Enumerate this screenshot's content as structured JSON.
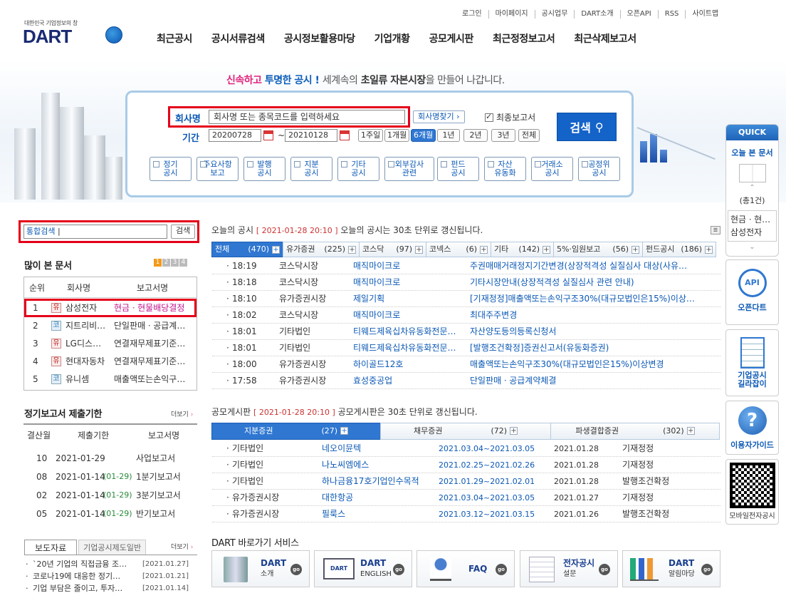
{
  "header": {
    "top_links": [
      "로그인",
      "마이페이지",
      "공시업무",
      "DART소개",
      "오픈API",
      "RSS",
      "사이트맵"
    ],
    "logo_sub": "대한민국 기업정보의 창",
    "logo": "DART",
    "nav": [
      "최근공시",
      "공시서류검색",
      "공시정보활용마당",
      "기업개황",
      "공모게시판",
      "최근정정보고서",
      "최근삭제보고서"
    ]
  },
  "tagline": {
    "p1": "신속하고",
    "p2": "투명한 공시 !",
    "p3": "세계속의",
    "p4": "초일류",
    "p5": "자본시장",
    "p6": "을 만들어 나갑니다."
  },
  "search": {
    "company_label": "회사명",
    "company_placeholder": "회사명 또는 종목코드를 입력하세요",
    "find_btn": "회사명찾기 ›",
    "final_report_label": "최종보고서",
    "period_label": "기간",
    "date_from": "20200728",
    "date_to": "20210128",
    "tilde": "~",
    "periods": [
      "1주일",
      "1개월",
      "6개월",
      "1년",
      "2년",
      "3년",
      "전체"
    ],
    "period_selected": "6개월",
    "search_btn": "검색",
    "categories": [
      [
        "정기",
        "공시"
      ],
      [
        "주요사항",
        "보고"
      ],
      [
        "발행",
        "공시"
      ],
      [
        "지분",
        "공시"
      ],
      [
        "기타",
        "공시"
      ],
      [
        "외부감사",
        "관련"
      ],
      [
        "펀드",
        "공시"
      ],
      [
        "자산",
        "유동화"
      ],
      [
        "거래소",
        "공시"
      ],
      [
        "공정위",
        "공시"
      ]
    ]
  },
  "integrated": {
    "placeholder": "통합검색",
    "btn": "검색"
  },
  "most_viewed": {
    "title": "많이 본 문서",
    "pages": [
      "1",
      "2",
      "3",
      "4"
    ],
    "headers": [
      "순위",
      "회사명",
      "보고서명"
    ],
    "rows": [
      {
        "rank": "1",
        "type": "유",
        "company": "삼성전자",
        "report": "현금ㆍ현물배당결정"
      },
      {
        "rank": "2",
        "type": "코",
        "company": "지트리비…",
        "report": "단일판매ㆍ공급계…"
      },
      {
        "rank": "3",
        "type": "유",
        "company": "LG디스…",
        "report": "연결재무제표기준…"
      },
      {
        "rank": "4",
        "type": "유",
        "company": "현대자동차",
        "report": "연결재무제표기준…"
      },
      {
        "rank": "5",
        "type": "코",
        "company": "유니셈",
        "report": "매출액또는손익구…"
      }
    ]
  },
  "periodic": {
    "title": "정기보고서 제출기한",
    "more": "더보기",
    "headers": [
      "결산월",
      "제출기한",
      "보고서명"
    ],
    "rows": [
      {
        "m": "10",
        "d": "2021-01-29",
        "x": "",
        "r": "사업보고서"
      },
      {
        "m": "08",
        "d": "2021-01-14",
        "x": "(01-29)",
        "r": "1분기보고서"
      },
      {
        "m": "02",
        "d": "2021-01-14",
        "x": "(01-29)",
        "r": "3분기보고서"
      },
      {
        "m": "05",
        "d": "2021-01-14",
        "x": "(01-29)",
        "r": "반기보고서"
      }
    ]
  },
  "press": {
    "tabs": [
      "보도자료",
      "기업공시제도일반"
    ],
    "more": "더보기",
    "items": [
      {
        "t": "`20년 기업의 직접금융 조…",
        "d": "[2021.01.27]"
      },
      {
        "t": "코로나19에 대응한 정기…",
        "d": "[2021.01.21]"
      },
      {
        "t": "기업 부담은 줄이고, 투자…",
        "d": "[2021.01.14]"
      }
    ]
  },
  "today": {
    "title": "오늘의 공시",
    "time": "[ 2021-01-28 20:10 ]",
    "note": "오늘의 공시는 30초 단위로 갱신됩니다.",
    "tabs": [
      {
        "name": "전체",
        "count": "(470)"
      },
      {
        "name": "유가증권",
        "count": "(225)"
      },
      {
        "name": "코스닥",
        "count": "(97)"
      },
      {
        "name": "코넥스",
        "count": "(6)"
      },
      {
        "name": "기타",
        "count": "(142)"
      },
      {
        "name": "5%·임원보고",
        "count": "(56)"
      },
      {
        "name": "펀드공시",
        "count": "(186)"
      }
    ],
    "rows": [
      {
        "time": "18:19",
        "market": "코스닥시장",
        "company": "매직마이크로",
        "report": "주권매매거래정지기간변경(상장적격성 실질심사 대상(사유…"
      },
      {
        "time": "18:18",
        "market": "코스닥시장",
        "company": "매직마이크로",
        "report": "기타시장안내(상장적격성 실질심사 관련 안내)"
      },
      {
        "time": "18:10",
        "market": "유가증권시장",
        "company": "제일기획",
        "report": "[기재정정]매출액또는손익구조30%(대규모법인은15%)이상…"
      },
      {
        "time": "18:02",
        "market": "코스닥시장",
        "company": "매직마이크로",
        "report": "최대주주변경"
      },
      {
        "time": "18:01",
        "market": "기타법인",
        "company": "티웨드제육십차유동화전문…",
        "report": "자산양도등의등록신청서"
      },
      {
        "time": "18:01",
        "market": "기타법인",
        "company": "티웨드제육십차유동화전문…",
        "report": "[발행조건확정]증권신고서(유동화증권)"
      },
      {
        "time": "18:00",
        "market": "유가증권시장",
        "company": "하이골드12호",
        "report": "매출액또는손익구조30%(대규모법인은15%)이상변경"
      },
      {
        "time": "17:58",
        "market": "유가증권시장",
        "company": "효성중공업",
        "report": "단일판매ㆍ공급계약체결"
      }
    ]
  },
  "ipo": {
    "title": "공모게시판",
    "time": "[ 2021-01-28 20:10 ]",
    "note": "공모게시판은 30초 단위로 갱신됩니다.",
    "tabs": [
      {
        "name": "지분증권",
        "count": "(27)"
      },
      {
        "name": "채무증권",
        "count": "(72)"
      },
      {
        "name": "파생결합증권",
        "count": "(302)"
      }
    ],
    "rows": [
      {
        "market": "기타법인",
        "company": "네오이뮨텍",
        "period": "2021.03.04~2021.03.05",
        "date": "2021.01.28",
        "status": "기재정정"
      },
      {
        "market": "기타법인",
        "company": "나노씨엠에스",
        "period": "2021.02.25~2021.02.26",
        "date": "2021.01.28",
        "status": "기재정정"
      },
      {
        "market": "기타법인",
        "company": "하나금융17호기업인수목적",
        "period": "2021.01.29~2021.02.01",
        "date": "2021.01.28",
        "status": "발행조건확정"
      },
      {
        "market": "유가증권시장",
        "company": "대한항공",
        "period": "2021.03.04~2021.03.05",
        "date": "2021.01.27",
        "status": "기재정정"
      },
      {
        "market": "유가증권시장",
        "company": "필룩스",
        "period": "2021.03.12~2021.03.15",
        "date": "2021.01.26",
        "status": "발행조건확정"
      }
    ]
  },
  "services": {
    "title": "DART 바로가기 서비스",
    "items": [
      [
        "DART",
        "소개"
      ],
      [
        "DART",
        "ENGLISH"
      ],
      [
        "FAQ",
        ""
      ],
      [
        "전자공시",
        "설문"
      ],
      [
        "DART",
        "알림마당"
      ]
    ],
    "go": "go"
  },
  "quick": {
    "title": "QUICK",
    "today_doc": "오늘 본 문서",
    "count": "(총1건)",
    "doc_line1": "현금ㆍ현…",
    "doc_line2": "삼성전자",
    "open_dart": "오픈다트",
    "api": "API",
    "guide": [
      "기업공시",
      "길라잡이"
    ],
    "user_guide": "이용자가이드",
    "mobile": "모바일전자공시"
  }
}
